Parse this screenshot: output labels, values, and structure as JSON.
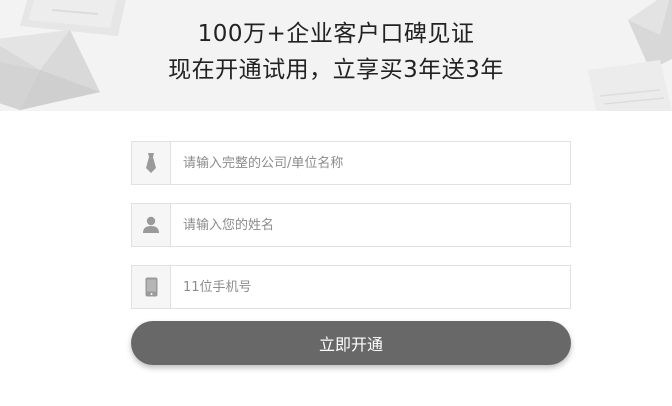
{
  "banner": {
    "headline_line1": "100万+企业客户口碑见证",
    "headline_line2": "现在开通试用，立享买3年送3年"
  },
  "form": {
    "company": {
      "icon": "tie-icon",
      "placeholder": "请输入完整的公司/单位名称",
      "value": ""
    },
    "name": {
      "icon": "user-icon",
      "placeholder": "请输入您的姓名",
      "value": ""
    },
    "phone": {
      "icon": "mobile-phone-icon",
      "placeholder": "11位手机号",
      "value": ""
    },
    "submit_label": "立即开通"
  },
  "colors": {
    "banner_bg": "#f3f3f3",
    "button_bg": "#686868",
    "border": "#e1e1e1"
  }
}
